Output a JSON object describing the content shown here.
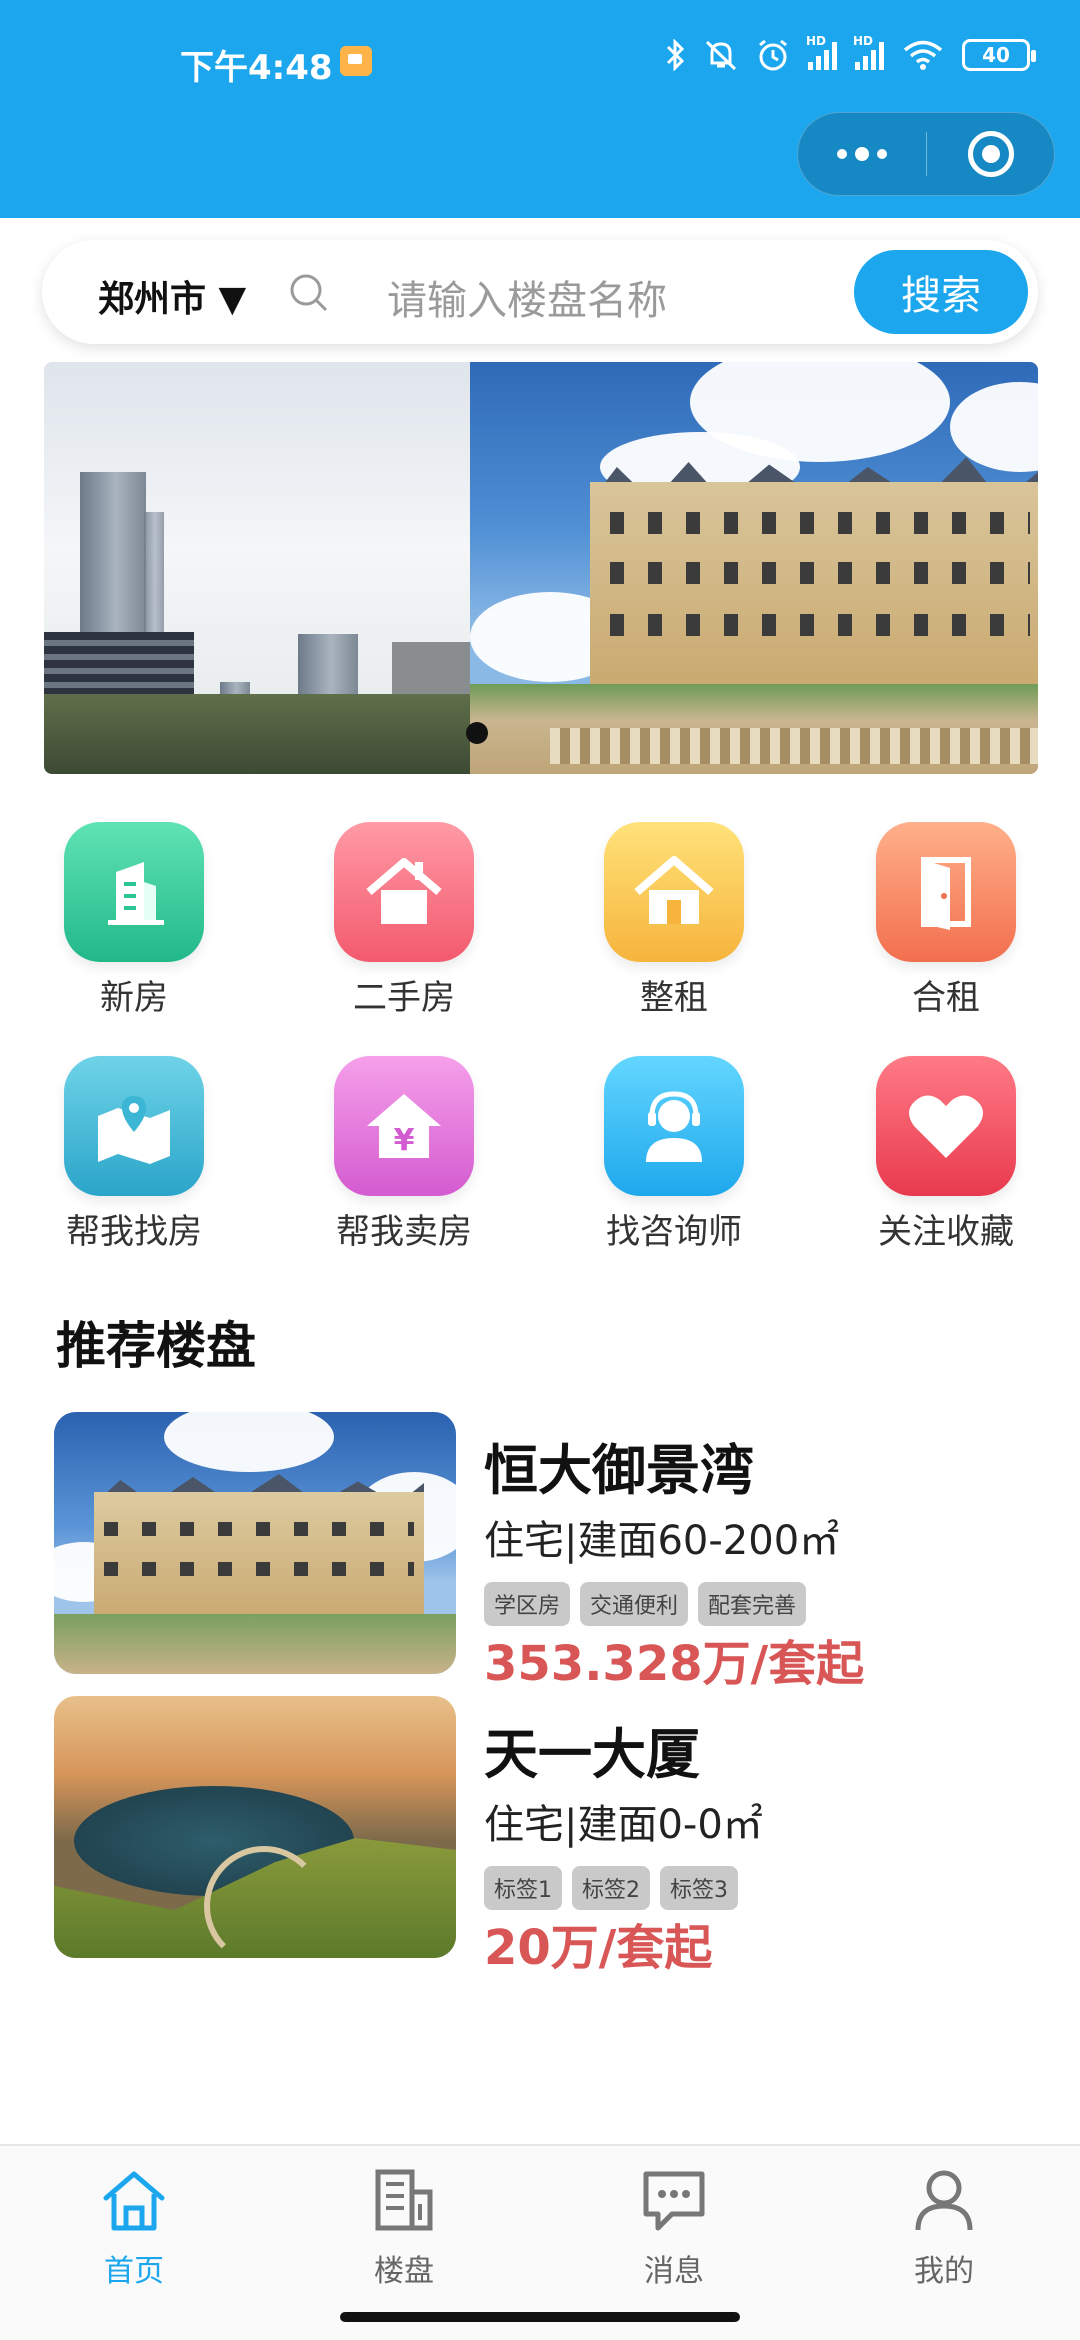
{
  "status_bar": {
    "time": "下午4:48",
    "battery": "40",
    "hd_label": "HD"
  },
  "search": {
    "city": "郑州市 ▼",
    "placeholder": "请输入楼盘名称",
    "button": "搜索"
  },
  "categories": [
    {
      "label": "新房",
      "icon": "building-icon"
    },
    {
      "label": "二手房",
      "icon": "house-icon"
    },
    {
      "label": "整租",
      "icon": "home-icon"
    },
    {
      "label": "合租",
      "icon": "door-icon"
    },
    {
      "label": "帮我找房",
      "icon": "map-pin-icon"
    },
    {
      "label": "帮我卖房",
      "icon": "yuan-house-icon"
    },
    {
      "label": "找咨询师",
      "icon": "headset-person-icon"
    },
    {
      "label": "关注收藏",
      "icon": "heart-icon"
    }
  ],
  "recommend": {
    "title": "推荐楼盘",
    "items": [
      {
        "name": "恒大御景湾",
        "meta": "住宅|建面60-200㎡",
        "tags": [
          "学区房",
          "交通便利",
          "配套完善"
        ],
        "price": "353.328万/套起"
      },
      {
        "name": "天一大厦",
        "meta": "住宅|建面0-0㎡",
        "tags": [
          "标签1",
          "标签2",
          "标签3"
        ],
        "price": "20万/套起"
      }
    ]
  },
  "tabbar": [
    {
      "label": "首页",
      "icon": "home-outline-icon",
      "active": true
    },
    {
      "label": "楼盘",
      "icon": "buildings-outline-icon",
      "active": false
    },
    {
      "label": "消息",
      "icon": "chat-bubble-icon",
      "active": false
    },
    {
      "label": "我的",
      "icon": "user-outline-icon",
      "active": false
    }
  ],
  "colors": {
    "primary": "#1ba6ee",
    "price": "#d85656",
    "tag_bg": "#c9c9c9"
  }
}
